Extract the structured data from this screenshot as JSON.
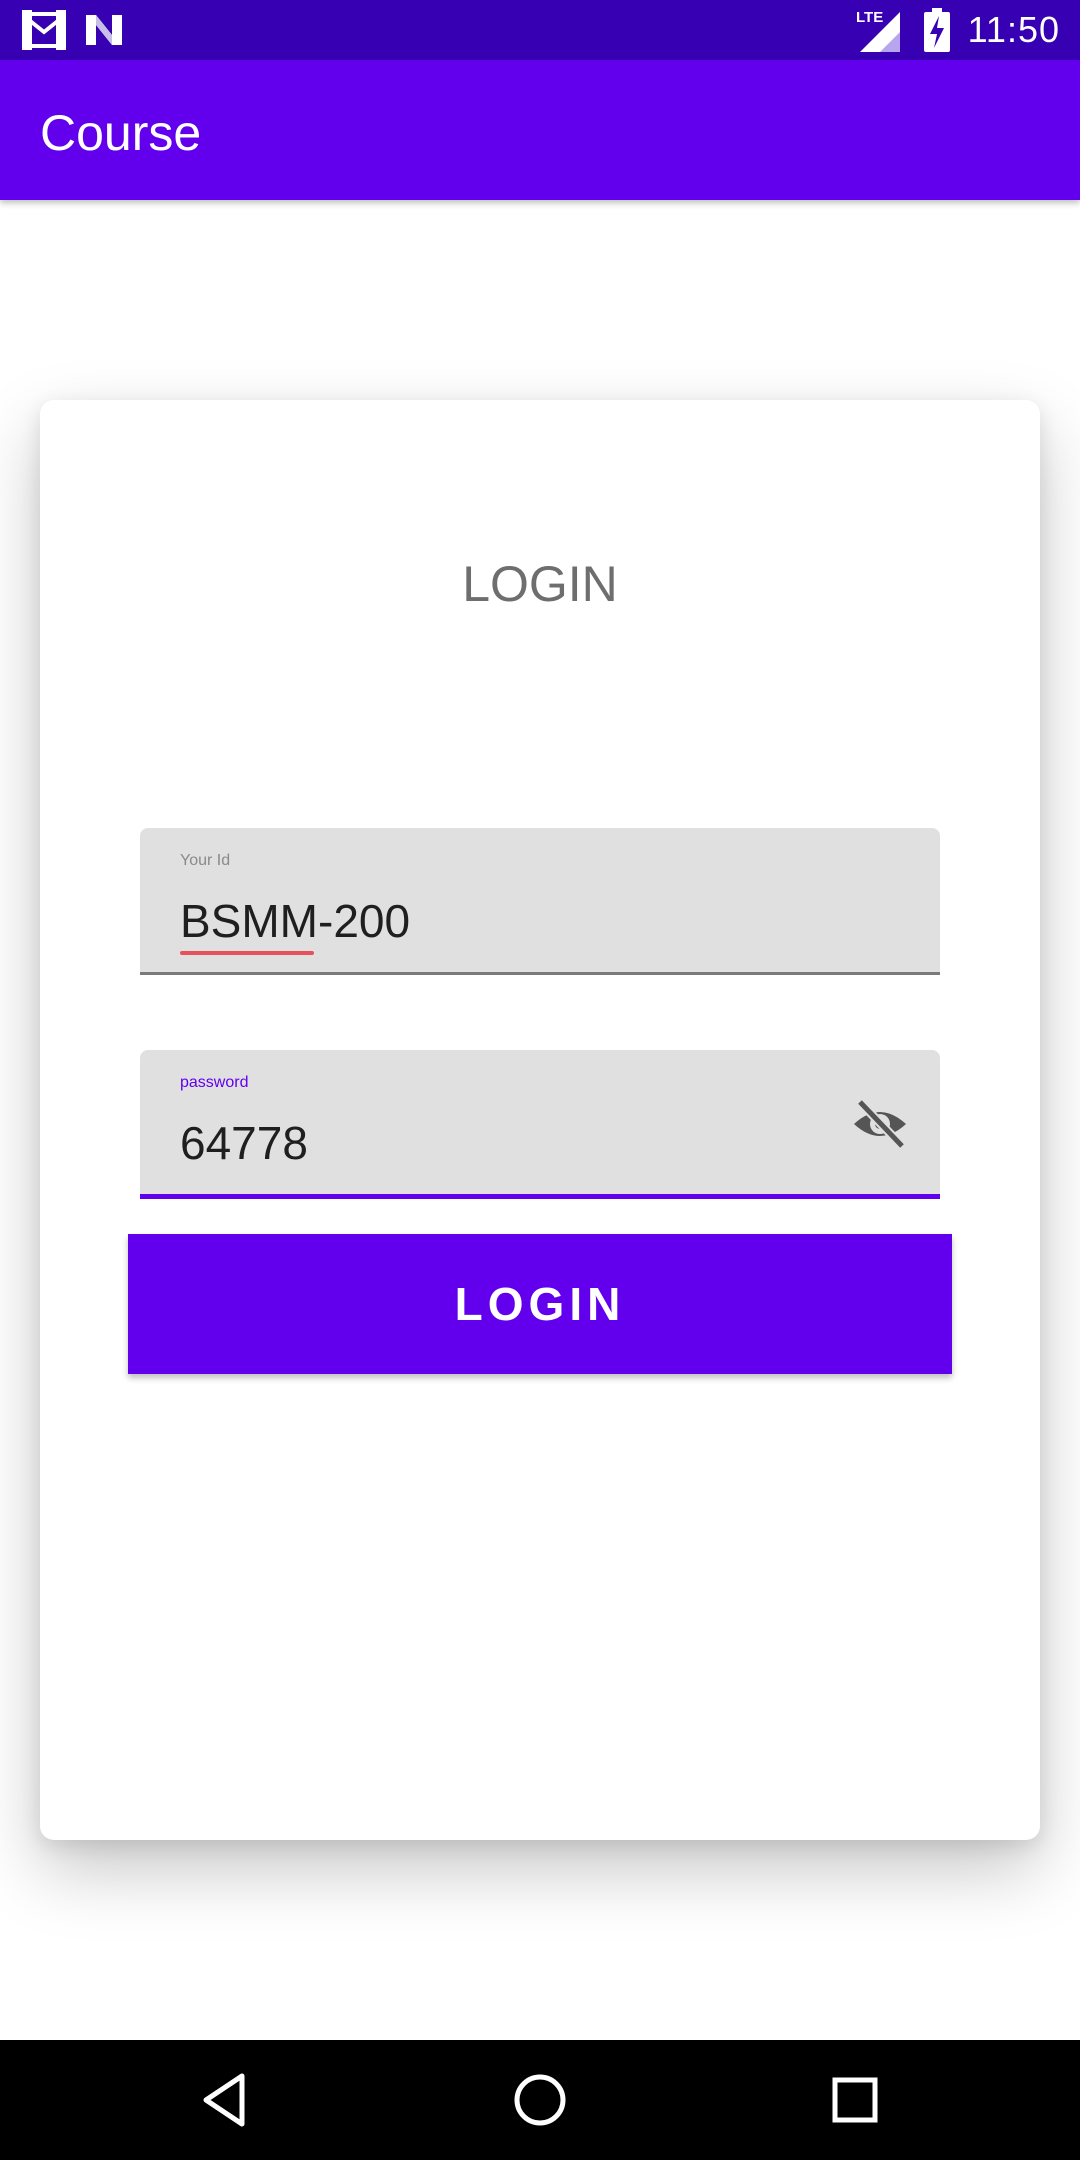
{
  "status_bar": {
    "time": "11:50",
    "network": "LTE",
    "left_icons": [
      "gmail-icon",
      "n-icon"
    ],
    "right_icons": [
      "signal-icon",
      "battery-charging-icon"
    ]
  },
  "app_bar": {
    "title": "Course",
    "color": "#6200ee"
  },
  "login_card": {
    "heading": "LOGIN",
    "id_field": {
      "label": "Your Id",
      "value": "BSMM-200"
    },
    "password_field": {
      "label": "password",
      "value": "64778",
      "toggle_icon": "eye-off-icon"
    },
    "login_button_label": "LOGIN"
  },
  "nav_bar": {
    "buttons": [
      "back-icon",
      "home-icon",
      "recents-icon"
    ]
  },
  "colors": {
    "primary": "#6200ee",
    "primary_dark": "#3700b3",
    "field_bg": "#e0e0e0",
    "spell_error": "#e8505b"
  }
}
